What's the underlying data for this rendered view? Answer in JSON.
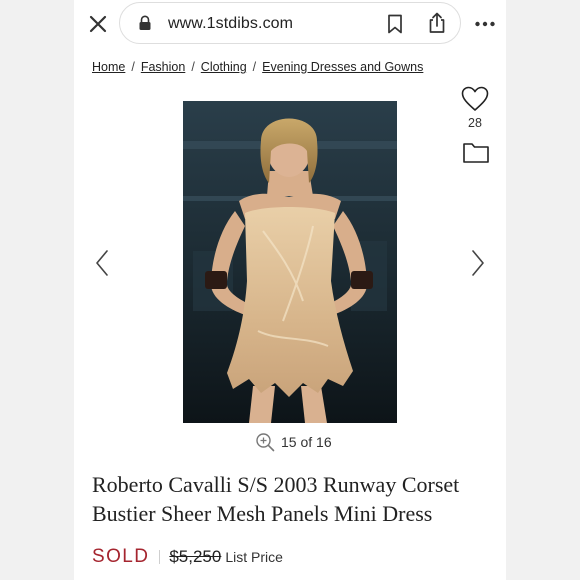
{
  "browser": {
    "url": "www.1stdibs.com",
    "icons": {
      "close": "close-icon",
      "lock": "lock-icon",
      "bookmark": "bookmark-icon",
      "share": "share-icon",
      "more": "more-icon"
    }
  },
  "breadcrumb": {
    "items": [
      "Home",
      "Fashion",
      "Clothing",
      "Evening Dresses and Gowns"
    ],
    "separator": "/"
  },
  "gallery": {
    "favorites_count": "28",
    "image_counter": "15 of 16"
  },
  "product": {
    "title": "Roberto Cavalli S/S 2003 Runway Corset Bustier Sheer Mesh Panels Mini Dress",
    "status": "SOLD",
    "price": "$5,250",
    "price_label": "List Price"
  },
  "colors": {
    "sold_red": "#a5252f",
    "text": "#222222",
    "background": "#f1f1f1"
  }
}
